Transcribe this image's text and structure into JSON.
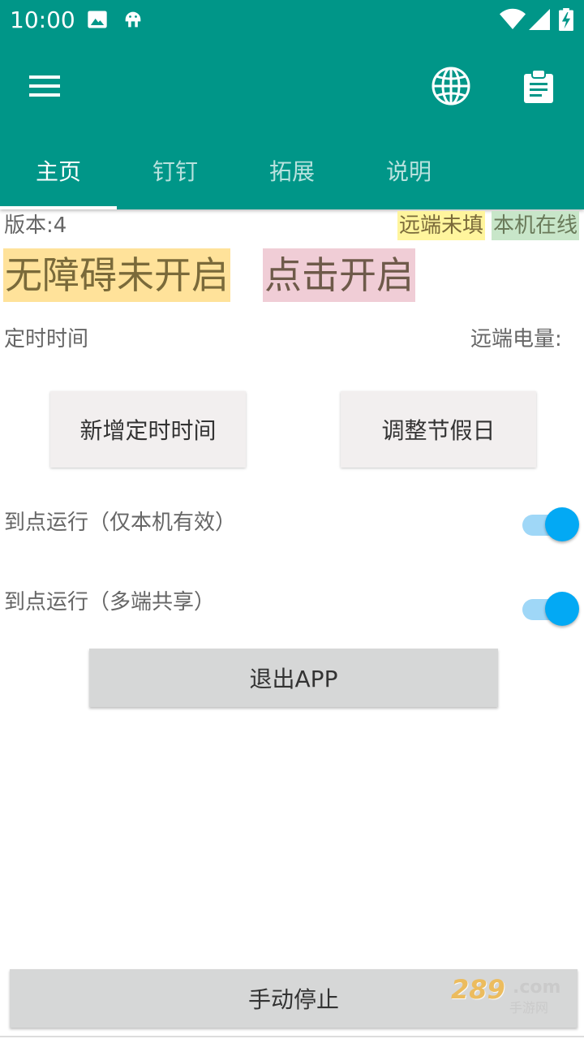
{
  "status_bar": {
    "time": "10:00"
  },
  "toolbar": {
    "menu_icon": "menu-icon",
    "language_icon": "globe-icon",
    "clipboard_icon": "clipboard-icon"
  },
  "tabs": [
    {
      "label": "主页",
      "active": true
    },
    {
      "label": "钉钉",
      "active": false
    },
    {
      "label": "拓展",
      "active": false
    },
    {
      "label": "说明",
      "active": false
    }
  ],
  "main": {
    "version": "版本:4",
    "remote_status": "远端未填",
    "local_status": "本机在线",
    "accessibility_status": "无障碍未开启",
    "open_link": "点击开启",
    "timer_label": "定时时间",
    "remote_battery_label": "远端电量:",
    "add_timer_button": "新增定时时间",
    "adjust_holiday_button": "调整节假日",
    "toggle_local_label": "到点运行（仅本机有效）",
    "toggle_local_on": true,
    "toggle_shared_label": "到点运行（多端共享）",
    "toggle_shared_on": true,
    "exit_button": "退出APP",
    "manual_stop_button": "手动停止"
  },
  "watermark": {
    "text_top": "289",
    "text_com": ".com",
    "text_bottom": "手游网"
  },
  "colors": {
    "primary": "#009688",
    "accent": "#03a9f4",
    "highlight_yellow": "#fff59d",
    "highlight_green": "#c8e6c9",
    "highlight_orange": "#ffe082",
    "highlight_pink": "#f0cdd6"
  }
}
